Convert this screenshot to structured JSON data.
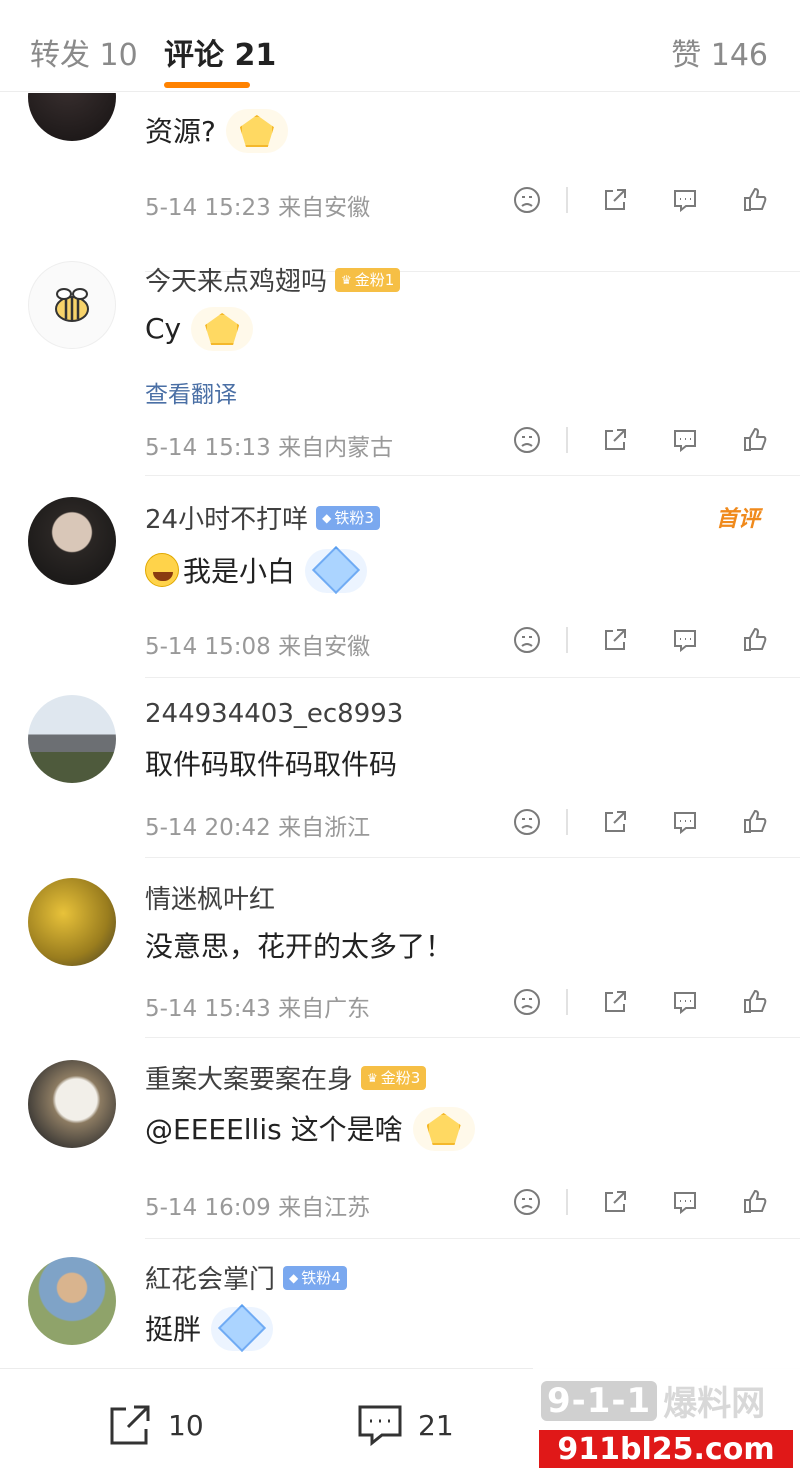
{
  "header": {
    "repost_tab": "转发 10",
    "comment_tab": "评论 21",
    "like_count": "赞 146"
  },
  "comments": [
    {
      "name": "",
      "badge": "",
      "text": "资源?",
      "translate": "",
      "meta": "5-14 15:23 来自安徽",
      "first": ""
    },
    {
      "name": "今天来点鸡翅吗",
      "badge": "金粉1",
      "text": "Cy",
      "translate": "查看翻译",
      "meta": "5-14 15:13 来自内蒙古",
      "first": ""
    },
    {
      "name": "24小时不打咩",
      "badge": "铁粉3",
      "text": "我是小白",
      "translate": "",
      "meta": "5-14 15:08 来自安徽",
      "first": "首评"
    },
    {
      "name": "244934403_ec8993",
      "badge": "",
      "text": "取件码取件码取件码",
      "translate": "",
      "meta": "5-14 20:42 来自浙江",
      "first": ""
    },
    {
      "name": "情迷枫叶红",
      "badge": "",
      "text": "没意思，花开的太多了！",
      "translate": "",
      "meta": "5-14 15:43 来自广东",
      "first": ""
    },
    {
      "name": "重案大案要案在身",
      "badge": "金粉3",
      "text": "@EEEEllis 这个是啥",
      "translate": "",
      "meta": "5-14 16:09 来自江苏",
      "first": ""
    },
    {
      "name": "紅花会掌门",
      "badge": "铁粉4",
      "text": "挺胖",
      "translate": "",
      "meta": "",
      "first": ""
    }
  ],
  "bottom_bar": {
    "share_count": "10",
    "comment_count": "21"
  },
  "watermark": {
    "logo": "9-1-1",
    "cn": "爆料网",
    "url": "911bl25.com"
  },
  "icons": [
    "dislike-icon",
    "share-icon",
    "reply-icon",
    "like-icon",
    "crown-icon",
    "diamond-icon",
    "laugh-cry-emoji"
  ],
  "colors": {
    "accent": "#ff8200",
    "gold_badge": "#f6bf45",
    "iron_badge": "#7aa8ef",
    "link": "#4a6fa5"
  }
}
